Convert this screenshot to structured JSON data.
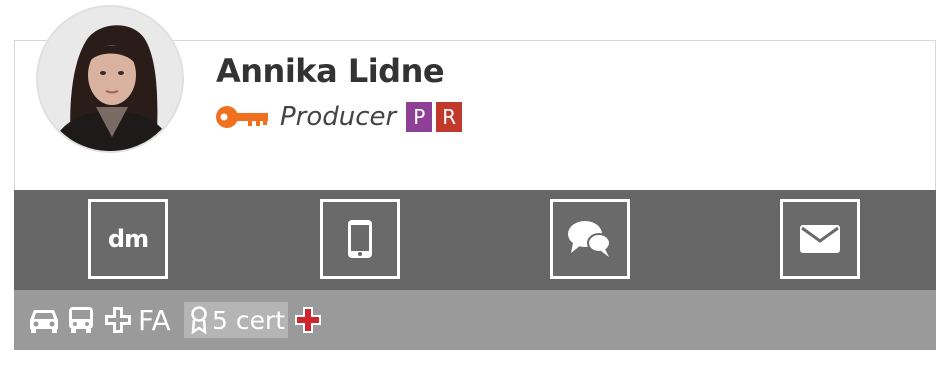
{
  "profile": {
    "name": "Annika Lidne",
    "role": "Producer",
    "badges": [
      {
        "letter": "P",
        "color": "#8e3f96"
      },
      {
        "letter": "R",
        "color": "#c0392b"
      }
    ],
    "key_icon_color": "#f07020"
  },
  "actions": [
    {
      "name": "dm-button",
      "label": "dm",
      "icon": "dm-text"
    },
    {
      "name": "phone-button",
      "icon": "mobile-phone-icon"
    },
    {
      "name": "chat-button",
      "icon": "chat-bubbles-icon"
    },
    {
      "name": "email-button",
      "icon": "envelope-icon"
    }
  ],
  "footer": {
    "icons": [
      "car-icon",
      "bus-icon",
      "first-aid-cross-icon"
    ],
    "fa_label": "FA",
    "cert_label": "5 cert",
    "cert_icon": "award-ribbon-icon",
    "red_cross_icon": "red-cross-icon",
    "red_cross_color": "#d0252f"
  },
  "colors": {
    "action_bar": "#666666",
    "footer_bar": "#9a9a9a"
  }
}
